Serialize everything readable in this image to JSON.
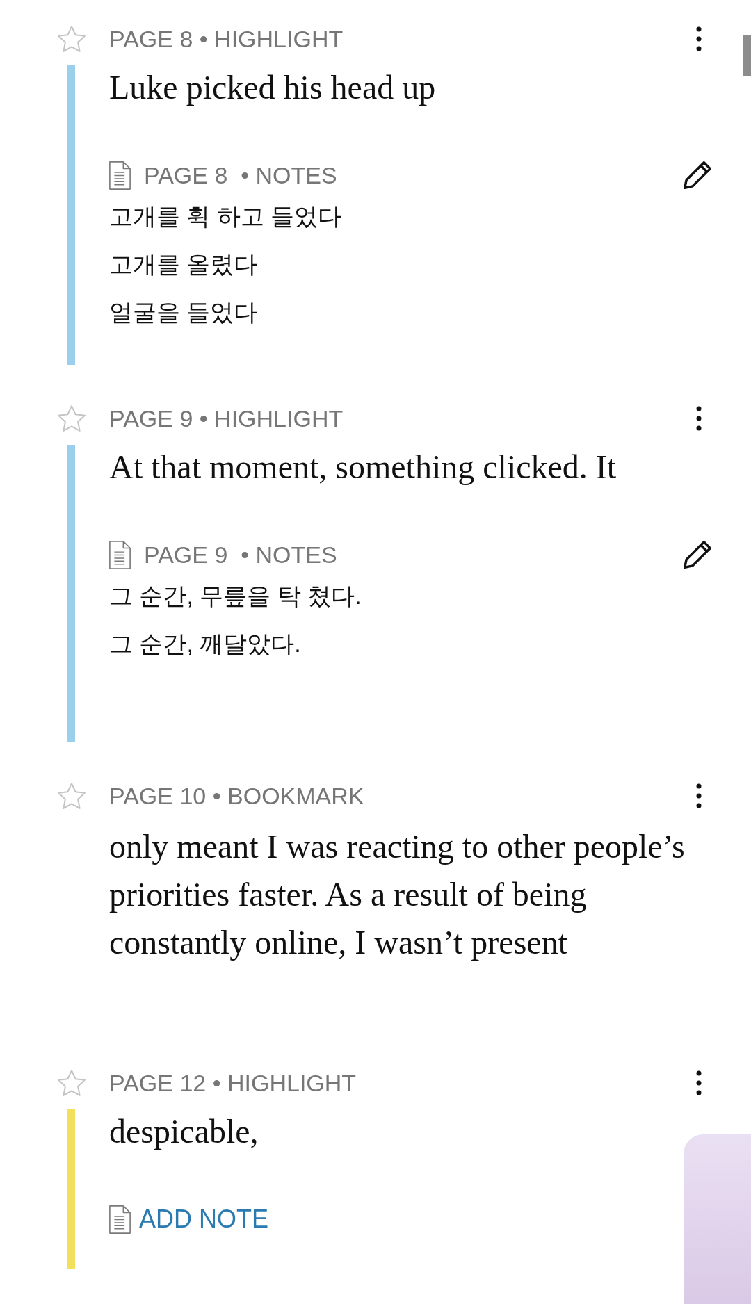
{
  "annotations": [
    {
      "kind": "highlight",
      "starred": false,
      "header": "PAGE 8 • HIGHLIGHT",
      "color": "#9ad0ec",
      "text": "Luke picked his head up",
      "note": {
        "kind": "note",
        "header": "PAGE 8  • NOTES",
        "lines": [
          "고개를 휙 하고 들었다",
          "고개를 올렸다",
          "얼굴을 들었다"
        ]
      }
    },
    {
      "kind": "highlight",
      "starred": false,
      "header": "PAGE 9 • HIGHLIGHT",
      "color": "#9ad0ec",
      "text": "At that moment, something clicked. It",
      "note": {
        "kind": "note",
        "header": "PAGE 9  • NOTES",
        "lines": [
          "그 순간, 무릎을 탁 쳤다.",
          "그 순간, 깨달았다."
        ]
      }
    },
    {
      "kind": "bookmark",
      "starred": false,
      "header": "PAGE 10 • BOOKMARK",
      "text": "only meant I was reacting to other people’s priorities faster. As a result of being constantly online, I wasn’t present"
    },
    {
      "kind": "highlight",
      "starred": false,
      "header": "PAGE 12 • HIGHLIGHT",
      "color": "#f2df5b",
      "text": "despicable,",
      "note": {
        "kind": "add",
        "label": "ADD NOTE"
      }
    }
  ]
}
